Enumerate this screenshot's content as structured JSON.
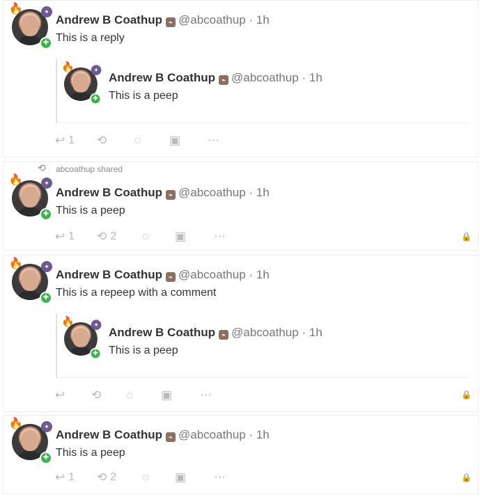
{
  "user": {
    "name": "Andrew B Coathup",
    "handle": "@abcoathup",
    "time": "1h"
  },
  "posts": [
    {
      "text": "This is a reply",
      "quote_text": "This is a peep",
      "actions": {
        "reply_count": "1",
        "repeep_count": "",
        "lock": false
      }
    },
    {
      "shared_by": "abcoathup shared",
      "text": "This is a peep",
      "actions": {
        "reply_count": "1",
        "repeep_count": "2",
        "lock": true
      }
    },
    {
      "text": "This is a repeep with a comment",
      "quote_text": "This is a peep",
      "actions": {
        "reply_count": "",
        "repeep_count": "",
        "lock": true
      }
    },
    {
      "text": "This is a peep",
      "actions": {
        "reply_count": "1",
        "repeep_count": "2",
        "lock": true
      }
    }
  ],
  "icons": {
    "reply": "reply-icon",
    "repeep": "repeep-icon",
    "github": "github-icon",
    "money": "money-icon",
    "more": "more-icon",
    "lock": "lock-icon",
    "flame": "flame-icon"
  }
}
